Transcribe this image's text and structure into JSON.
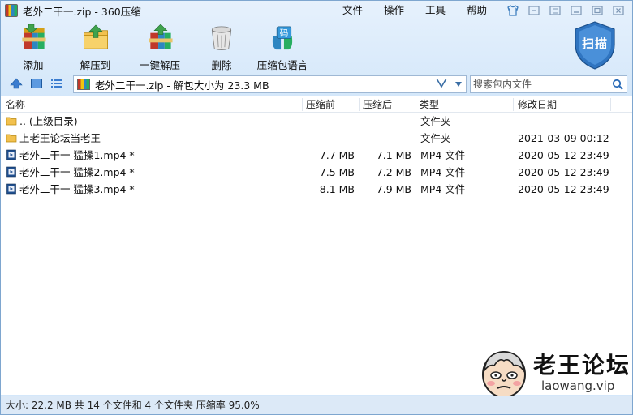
{
  "window": {
    "title": "老外二干一.zip - 360压缩"
  },
  "menu": [
    "文件",
    "操作",
    "工具",
    "帮助"
  ],
  "toolbar": {
    "add": "添加",
    "extract_to": "解压到",
    "one_click_extract": "一键解压",
    "delete": "删除",
    "lang_pack": "压缩包语言",
    "lang_pack_icon_text": "码",
    "scan": "扫描"
  },
  "address": {
    "path": "老外二干一.zip - 解包大小为 23.3 MB"
  },
  "search": {
    "placeholder": "搜索包内文件"
  },
  "columns": {
    "name": "名称",
    "compressed": "压缩前",
    "after": "压缩后",
    "type": "类型",
    "modified": "修改日期"
  },
  "files": [
    {
      "name": ".. (上级目录)",
      "before": "",
      "after": "",
      "type": "文件夹",
      "date": "",
      "icon": "folder-icon"
    },
    {
      "name": "上老王论坛当老王",
      "before": "",
      "after": "",
      "type": "文件夹",
      "date": "2021-03-09 00:12",
      "icon": "folder-icon"
    },
    {
      "name": "老外二干一 猛操1.mp4 *",
      "before": "7.7 MB",
      "after": "7.1 MB",
      "type": "MP4 文件",
      "date": "2020-05-12 23:49",
      "icon": "video-file-icon"
    },
    {
      "name": "老外二干一 猛操2.mp4 *",
      "before": "7.5 MB",
      "after": "7.2 MB",
      "type": "MP4 文件",
      "date": "2020-05-12 23:49",
      "icon": "video-file-icon"
    },
    {
      "name": "老外二干一 猛操3.mp4 *",
      "before": "8.1 MB",
      "after": "7.9 MB",
      "type": "MP4 文件",
      "date": "2020-05-12 23:49",
      "icon": "video-file-icon"
    }
  ],
  "watermark": {
    "title": "老王论坛",
    "site": "laowang.vip"
  },
  "status": {
    "text": "大小: 22.2 MB 共 14 个文件和 4 个文件夹 压缩率 95.0%"
  },
  "colors": {
    "accent": "#2b6cb8",
    "folder": "#f2c14e",
    "scan_badge": "#2f74c0"
  }
}
